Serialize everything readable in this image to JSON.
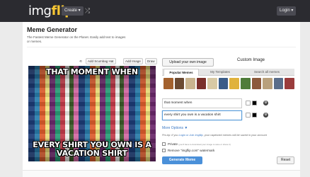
{
  "header": {
    "logo_pre": "img",
    "logo_post": "flip",
    "create_label": "Create ▾",
    "shuffle_icon": "shuffle-icon",
    "login_label": "Login ▾"
  },
  "page": {
    "title": "Meme Generator",
    "subtitle": "The Fastest Meme Generator on the Planet. Easily add text to images or memes."
  },
  "toolbar": {
    "add_scumbag_label": "Add Scumbag Hat",
    "add_image_label": "Add Image",
    "draw_label": "Draw"
  },
  "meme": {
    "top_text": "THAT MOMENT WHEN",
    "bottom_text": "EVERY SHIRT YOU OWN IS A VACATION SHIRT"
  },
  "picker": {
    "upload_label": "Upload your own image",
    "custom_label": "Custom Image",
    "tabs": [
      "Popular Memes",
      "My Templates",
      "Search all memes"
    ]
  },
  "text_boxes": {
    "box1": "that moment when",
    "box2": "every shirt you own is a vacation shirt"
  },
  "options": {
    "more_options": "More Options ▼",
    "protip_pre": "Pro-tip: If you",
    "protip_link": "Login or Join Imgflip",
    "protip_post": ", your captioned memes will be saved in your account",
    "private_label": "Private",
    "private_note": "(you'll have to download your image to save or share it)",
    "watermark_label": "Remove \"imgflip.com\" watermark"
  },
  "actions": {
    "generate_label": "Generate Meme",
    "reset_label": "Reset"
  },
  "colors": {
    "topbar": "#2b2b30",
    "accent": "#4a90d9",
    "logo_accent": "#f8c733"
  }
}
